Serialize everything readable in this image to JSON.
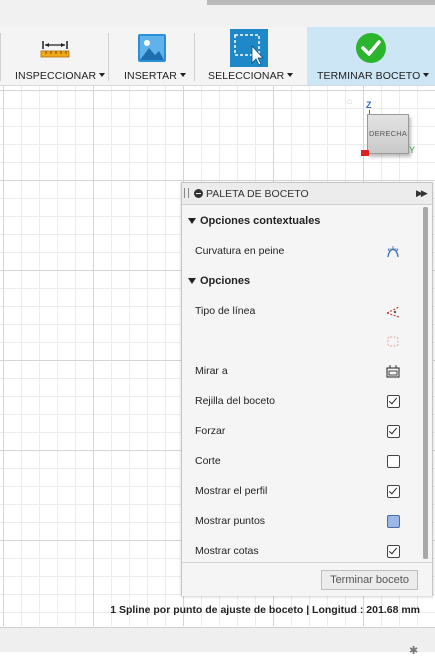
{
  "toolbar": {
    "inspect_label": "INSPECCIONAR",
    "insert_label": "INSERTAR",
    "select_label": "SELECCIONAR",
    "finish_label": "TERMINAR BOCETO"
  },
  "viewcube": {
    "face_label": "DERECHA",
    "z_label": "Z",
    "y_label": "Y"
  },
  "palette": {
    "title": "PALETA DE BOCETO",
    "sections": {
      "contextual": "Opciones contextuales",
      "options": "Opciones"
    },
    "rows": {
      "curvature": "Curvatura en peine",
      "line_type": "Tipo de línea",
      "look_at": "Mirar a",
      "grid": "Rejilla del boceto",
      "snap": "Forzar",
      "slice": "Corte",
      "show_profile": "Mostrar el perfil",
      "show_points": "Mostrar puntos",
      "show_dimensions": "Mostrar cotas"
    },
    "checks": {
      "grid": true,
      "snap": true,
      "slice": false,
      "show_profile": true,
      "show_points": true,
      "show_dimensions": true
    },
    "finish_button": "Terminar boceto"
  },
  "status": {
    "text": "1 Spline por punto de ajuste de boceto | Longitud : 201.68 mm"
  },
  "colors": {
    "accent": "#1e88c8",
    "finish_bg": "#cde6f6",
    "check_green": "#2bb52f"
  }
}
